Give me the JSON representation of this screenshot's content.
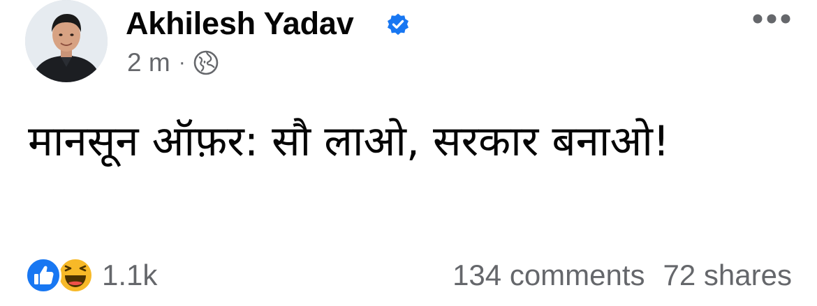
{
  "author": {
    "name": "Akhilesh Yadav",
    "verified": true
  },
  "meta": {
    "time": "2 m",
    "separator": "·",
    "audience_icon": "globe-icon"
  },
  "post": {
    "text": "मानसून ऑफ़र: सौ लाओ, सरकार बनाओ!"
  },
  "reactions": {
    "icons": [
      "like-icon",
      "haha-icon"
    ],
    "count": "1.1k"
  },
  "engagement": {
    "comments": "134 comments",
    "shares": "72 shares"
  },
  "colors": {
    "primary_text": "#050505",
    "secondary_text": "#65676b",
    "facebook_blue": "#1877f2",
    "haha_yellow": "#f7b928"
  }
}
